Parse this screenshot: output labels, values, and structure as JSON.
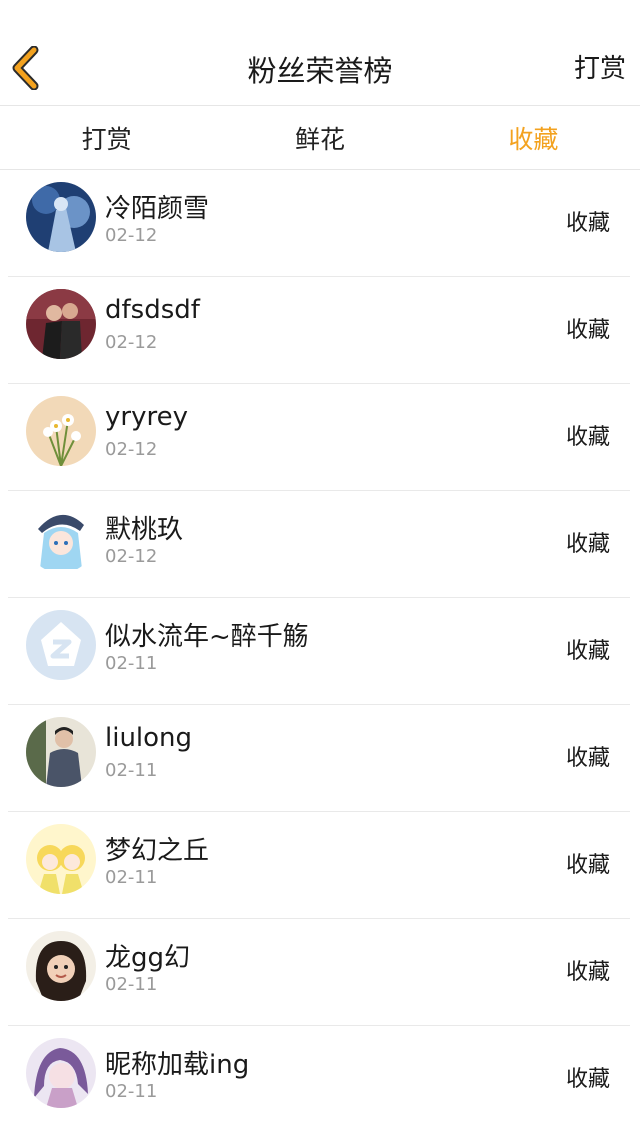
{
  "navbar": {
    "title": "粉丝荣誉榜",
    "right_label": "打赏",
    "back_icon": "chevron-left-icon",
    "back_icon_color": "#f3a21f"
  },
  "tabs": [
    {
      "label": "打赏",
      "active": false
    },
    {
      "label": "鲜花",
      "active": false
    },
    {
      "label": "收藏",
      "active": true
    }
  ],
  "accent_color": "#f3a21f",
  "fans": [
    {
      "name": "冷陌颜雪",
      "date": "02-12",
      "action": "收藏"
    },
    {
      "name": "dfsdsdf",
      "date": "02-12",
      "action": "收藏"
    },
    {
      "name": "yryrey",
      "date": "02-12",
      "action": "收藏"
    },
    {
      "name": "默桃玖",
      "date": "02-12",
      "action": "收藏"
    },
    {
      "name": "似水流年~醉千觞",
      "date": "02-11",
      "action": "收藏"
    },
    {
      "name": "liulong",
      "date": "02-11",
      "action": "收藏"
    },
    {
      "name": "梦幻之丘",
      "date": "02-11",
      "action": "收藏"
    },
    {
      "name": "龙gg幻",
      "date": "02-11",
      "action": "收藏"
    },
    {
      "name": "昵称加载ing",
      "date": "02-11",
      "action": "收藏"
    }
  ]
}
